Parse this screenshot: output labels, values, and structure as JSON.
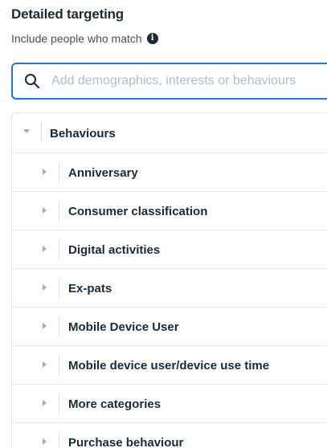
{
  "section": {
    "title": "Detailed targeting",
    "subtitle": "Include people who match"
  },
  "search": {
    "placeholder": "Add demographics, interests or behaviours"
  },
  "tree": {
    "header": {
      "label": "Behaviours",
      "expanded": true
    },
    "items": [
      {
        "label": "Anniversary"
      },
      {
        "label": "Consumer classification"
      },
      {
        "label": "Digital activities"
      },
      {
        "label": "Ex-pats"
      },
      {
        "label": "Mobile Device User"
      },
      {
        "label": "Mobile device user/device use time"
      },
      {
        "label": "More categories"
      },
      {
        "label": "Purchase behaviour"
      }
    ]
  },
  "icons": {
    "search": "search-icon",
    "info": "info-icon",
    "expand": "caret-down-icon",
    "collapse": "caret-right-icon"
  },
  "colors": {
    "accent": "#1877f2",
    "text": "#1c2b33",
    "muted": "#4b4f56",
    "divider": "#e4e6eb"
  }
}
